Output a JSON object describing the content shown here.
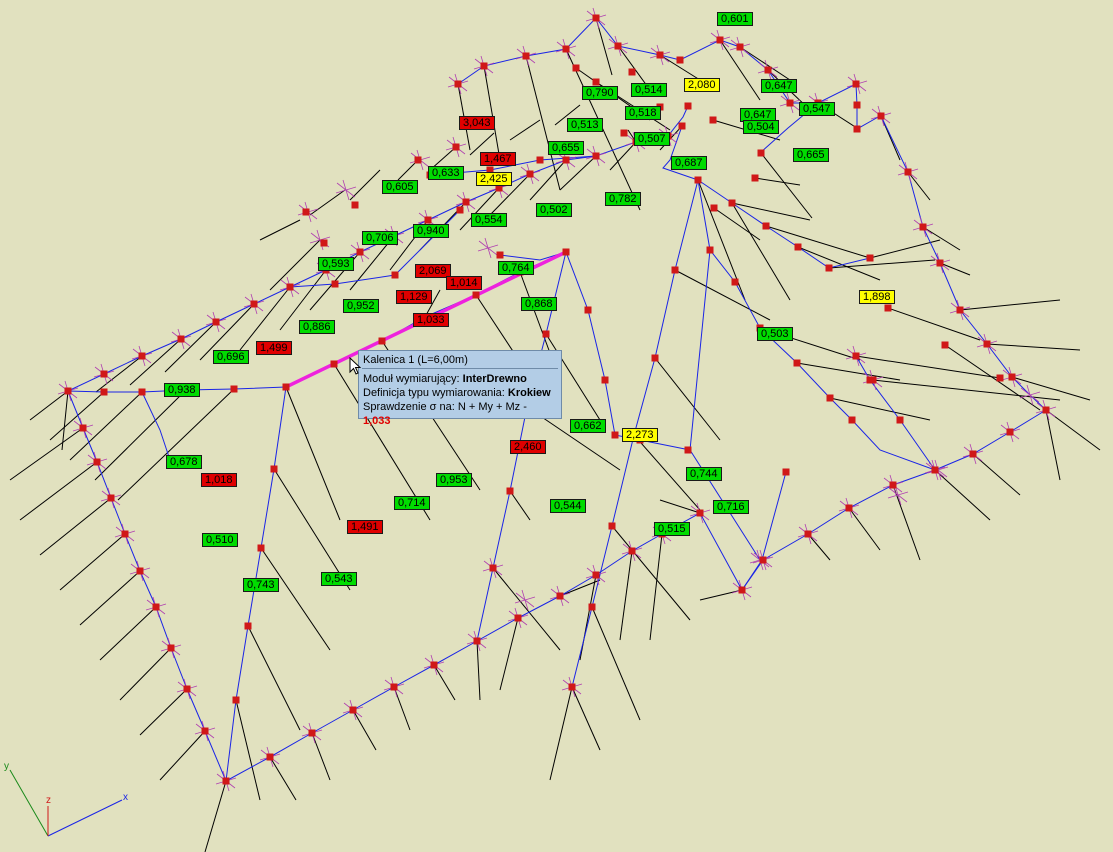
{
  "colors": {
    "background": "#e1e1bf",
    "beam_blue": "#1a24e6",
    "member_black": "#000000",
    "node_red": "#d01818",
    "support_magenta": "#b040b0",
    "selected_magenta": "#ee22dd",
    "label_green": "#00dc00",
    "label_red": "#e00000",
    "label_yellow": "#ffff00"
  },
  "labels": [
    {
      "text": "0,601",
      "color": "green"
    },
    {
      "text": "0,790",
      "color": "green"
    },
    {
      "text": "0,514",
      "color": "green"
    },
    {
      "text": "2,080",
      "color": "yellow"
    },
    {
      "text": "0,647",
      "color": "green"
    },
    {
      "text": "0,518",
      "color": "green"
    },
    {
      "text": "0,647",
      "color": "green"
    },
    {
      "text": "0,547",
      "color": "green"
    },
    {
      "text": "3,043",
      "color": "red"
    },
    {
      "text": "0,513",
      "color": "green"
    },
    {
      "text": "0,504",
      "color": "green"
    },
    {
      "text": "0,507",
      "color": "green"
    },
    {
      "text": "0,655",
      "color": "green"
    },
    {
      "text": "1,467",
      "color": "red"
    },
    {
      "text": "0,665",
      "color": "green"
    },
    {
      "text": "0,687",
      "color": "green"
    },
    {
      "text": "0,633",
      "color": "green"
    },
    {
      "text": "2,425",
      "color": "yellow"
    },
    {
      "text": "0,605",
      "color": "green"
    },
    {
      "text": "0,782",
      "color": "green"
    },
    {
      "text": "0,502",
      "color": "green"
    },
    {
      "text": "0,554",
      "color": "green"
    },
    {
      "text": "0,706",
      "color": "green"
    },
    {
      "text": "0,940",
      "color": "green"
    },
    {
      "text": "0,593",
      "color": "green"
    },
    {
      "text": "2,069",
      "color": "red"
    },
    {
      "text": "0,764",
      "color": "green"
    },
    {
      "text": "1,014",
      "color": "red"
    },
    {
      "text": "1,129",
      "color": "red"
    },
    {
      "text": "0,952",
      "color": "green"
    },
    {
      "text": "0,868",
      "color": "green"
    },
    {
      "text": "1,898",
      "color": "yellow"
    },
    {
      "text": "1,033",
      "color": "red"
    },
    {
      "text": "0,886",
      "color": "green"
    },
    {
      "text": "0,503",
      "color": "green"
    },
    {
      "text": "1,499",
      "color": "red"
    },
    {
      "text": "0,696",
      "color": "green"
    },
    {
      "text": "0,938",
      "color": "green"
    },
    {
      "text": "0,662",
      "color": "green"
    },
    {
      "text": "2,273",
      "color": "yellow"
    },
    {
      "text": "2,460",
      "color": "red"
    },
    {
      "text": "0,678",
      "color": "green"
    },
    {
      "text": "0,744",
      "color": "green"
    },
    {
      "text": "1,018",
      "color": "red"
    },
    {
      "text": "0,953",
      "color": "green"
    },
    {
      "text": "0,714",
      "color": "green"
    },
    {
      "text": "0,544",
      "color": "green"
    },
    {
      "text": "0,716",
      "color": "green"
    },
    {
      "text": "1,491",
      "color": "red"
    },
    {
      "text": "0,515",
      "color": "green"
    },
    {
      "text": "0,510",
      "color": "green"
    },
    {
      "text": "0,543",
      "color": "green"
    },
    {
      "text": "0,743",
      "color": "green"
    }
  ],
  "tooltip": {
    "title": "Kalenica 1 (L=6,00m)",
    "module_label": "Moduł wymiarujący: ",
    "module_value": "InterDrewno",
    "def_label": "Definicja typu wymiarowania: ",
    "def_value": "Krokiew",
    "check_label": "Sprawdzenie σ na: N + My + Mz - ",
    "check_value": "1,033"
  },
  "axes": {
    "x": "x",
    "y": "y",
    "z": "z"
  },
  "axis_colors": {
    "x": "#1a24e6",
    "y": "#1a8a1a",
    "z": "#d01818"
  }
}
